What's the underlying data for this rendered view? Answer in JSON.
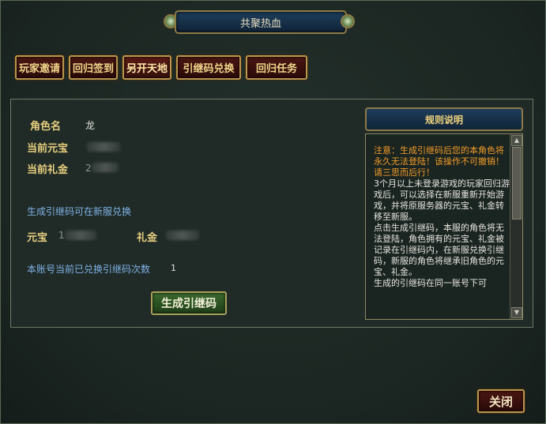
{
  "title": "共聚热血",
  "tabs": [
    {
      "label": "玩家邀请"
    },
    {
      "label": "回归签到"
    },
    {
      "label": "另开天地"
    },
    {
      "label": "引继码兑换"
    },
    {
      "label": "回归任务"
    }
  ],
  "character": {
    "name_label": "角色名",
    "name_value": "龙",
    "yuanbao_label": "当前元宝",
    "lijin_label": "当前礼金",
    "lijin_value_partial": "2"
  },
  "generate_info": "生成引继码可在新服兑换",
  "transfer": {
    "yuanbao_label": "元宝",
    "yuanbao_value_partial": "1",
    "lijin_label": "礼金"
  },
  "redeem_count": {
    "label": "本账号当前已兑换引继码次数",
    "value": "1"
  },
  "generate_button": "生成引继码",
  "rules": {
    "heading": "规则说明",
    "warning": "注意：生成引继码后您的本角色将永久无法登陆！该操作不可撤销！请三思而后行！",
    "paragraphs": [
      "3个月以上未登录游戏的玩家回归游戏后，可以选择在新服重新开始游戏，并将原服务器的元宝、礼金转移至新服。",
      "点击生成引继码，本服的角色将无法登陆，角色拥有的元宝、礼金被记录在引继码内，在新服兑换引继码，新服的角色将继承旧角色的元宝、礼金。",
      "生成的引继码在同一账号下可"
    ]
  },
  "close_button": "关闭",
  "colors": {
    "background": "#1c2723",
    "label_gold": "#e8cf80",
    "info_blue": "#7fb2e6",
    "warning_orange": "#f29c2a",
    "button_red": "#3a1210",
    "button_green": "#2e5424"
  }
}
